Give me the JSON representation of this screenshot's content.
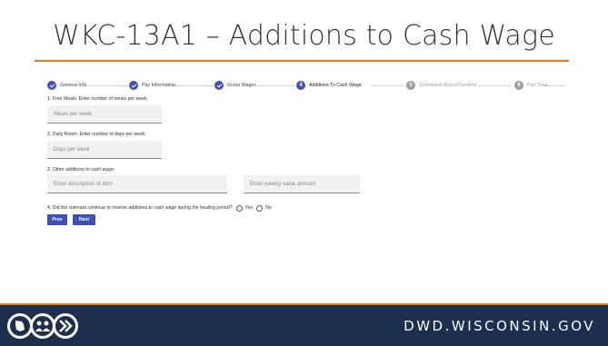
{
  "slide": {
    "title": "WKC-13A1 – Additions to Cash Wage",
    "accent_color": "#e07b22",
    "primary_color": "#3f51b5",
    "footer_bg": "#1c2f4f"
  },
  "stepper": {
    "steps": [
      {
        "label": "General Info",
        "state": "done",
        "icon": "check-icon"
      },
      {
        "label": "Pay Information",
        "state": "done",
        "icon": "check-icon"
      },
      {
        "label": "Gross Wages",
        "state": "done",
        "icon": "check-icon"
      },
      {
        "label": "Additions To Cash Wage",
        "state": "active",
        "number": "4"
      },
      {
        "label": "Scheduled Hours/Overtime",
        "state": "todo",
        "number": "5"
      },
      {
        "label": "Part Time",
        "state": "todo",
        "number": "6"
      }
    ]
  },
  "form": {
    "q1": "1. Free Meals: Enter number of meals per week.",
    "q1_placeholder": "Meals per week",
    "q2": "2. Daily Room: Enter number of days per week.",
    "q2_placeholder": "Days per week",
    "q3": "3. Other additions to cash wage:",
    "q3_desc_placeholder": "Enter description of item",
    "q3_amount_placeholder": "Enter weekly value amount",
    "q4": "4. Did the claimant continue to receive additions to cash wage during the healing period?",
    "yes_label": "Yes",
    "no_label": "No",
    "prev_label": "Prev",
    "next_label": "Next"
  },
  "footer": {
    "url": "DWD.WISCONSIN.GOV",
    "logo_icons": [
      "wisconsin-state-icon",
      "people-icon",
      "forward-arrow-icon"
    ]
  }
}
